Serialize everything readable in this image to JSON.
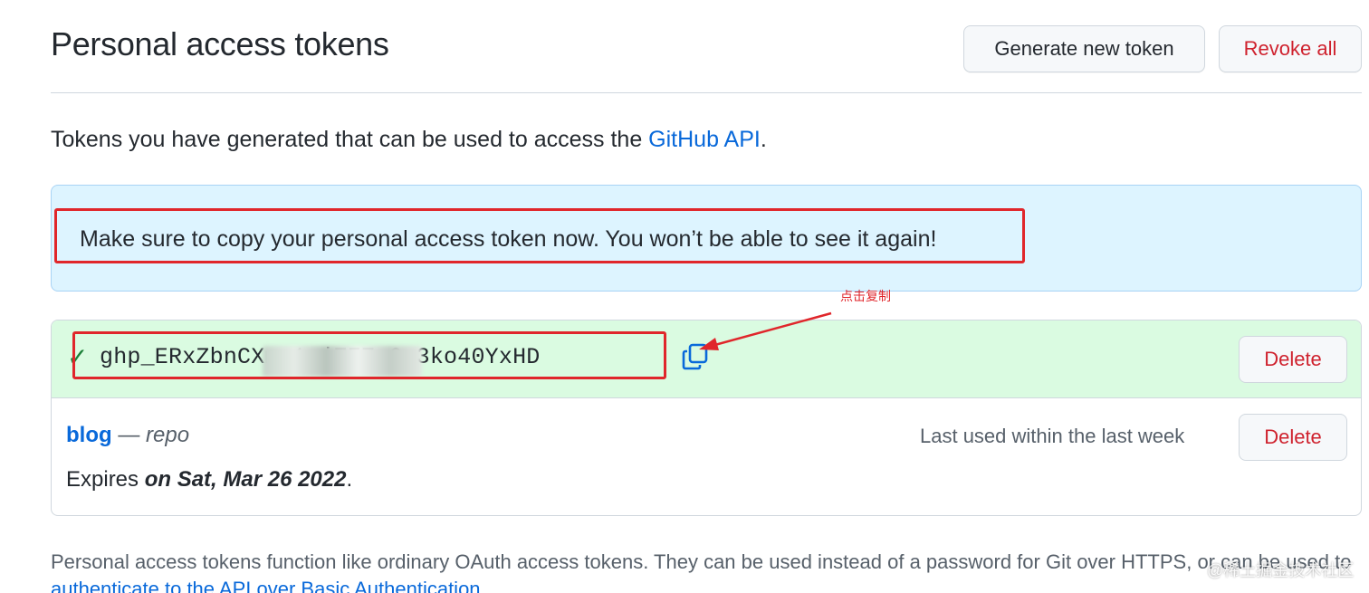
{
  "header": {
    "title": "Personal access tokens",
    "generate_label": "Generate new token",
    "revoke_label": "Revoke all"
  },
  "intro": {
    "text": "Tokens you have generated that can be used to access the ",
    "link": "GitHub API",
    "suffix": "."
  },
  "flash": {
    "message": "Make sure to copy your personal access token now. You won’t be able to see it again!"
  },
  "annotation": {
    "label": "点击复制",
    "color": "#e0262b"
  },
  "new_token": {
    "check_icon": "check-icon",
    "value": "ghp_ERxZbnCXm          1qjZFZg6o3ko40YxHD",
    "copy_icon": "copy-icon",
    "delete_label": "Delete"
  },
  "existing_token": {
    "name": "blog",
    "dash": " — ",
    "scope": "repo",
    "last_used": "Last used within the last week",
    "expires_prefix": "Expires ",
    "expires_date": "on Sat, Mar 26 2022",
    "expires_suffix": ".",
    "delete_label": "Delete"
  },
  "footer": {
    "text": "Personal access tokens function like ordinary OAuth access tokens. They can be used instead of a password for Git over HTTPS, or can be used to ",
    "link": "authenticate to the API over Basic Authentication",
    "suffix": "."
  },
  "watermark": "@稀土掘金技术社区",
  "colors": {
    "link": "#0969da",
    "danger": "#cf222e",
    "flash_bg": "#ddf4ff",
    "new_token_bg": "#dafbe1",
    "success": "#1a7f37"
  }
}
